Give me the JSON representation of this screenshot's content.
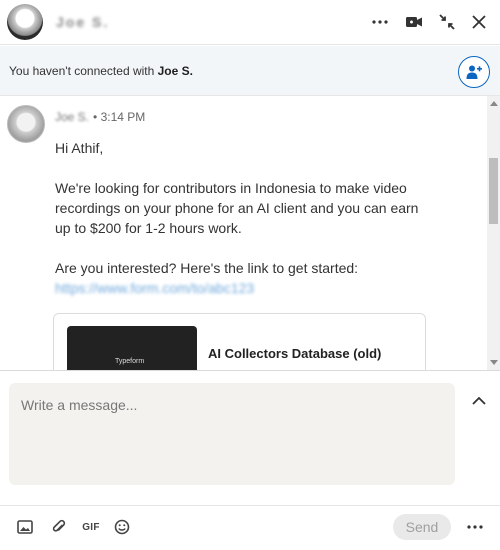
{
  "header": {
    "contact_name": "Joe S."
  },
  "banner": {
    "prefix": "You haven't connected with ",
    "name": "Joe S."
  },
  "message": {
    "sender": "Joe S.",
    "time": "3:14 PM",
    "greeting": "Hi Athif,",
    "paragraph1": "We're looking for contributors in Indonesia to make video recordings on your phone for an AI client and you can earn up to $200 for 1-2 hours work.",
    "paragraph2": "Are you interested? Here's the link to get started:",
    "link": "https://www.form.com/to/abc123"
  },
  "preview": {
    "thumb_label": "Typeform",
    "title": "AI Collectors Database (old)"
  },
  "composer": {
    "placeholder": "Write a message..."
  },
  "toolbar": {
    "gif_label": "GIF",
    "send_label": "Send"
  },
  "colors": {
    "accent": "#0a66c2",
    "banner_bg": "#f3f6f8",
    "composer_bg": "#f3f2ef"
  }
}
